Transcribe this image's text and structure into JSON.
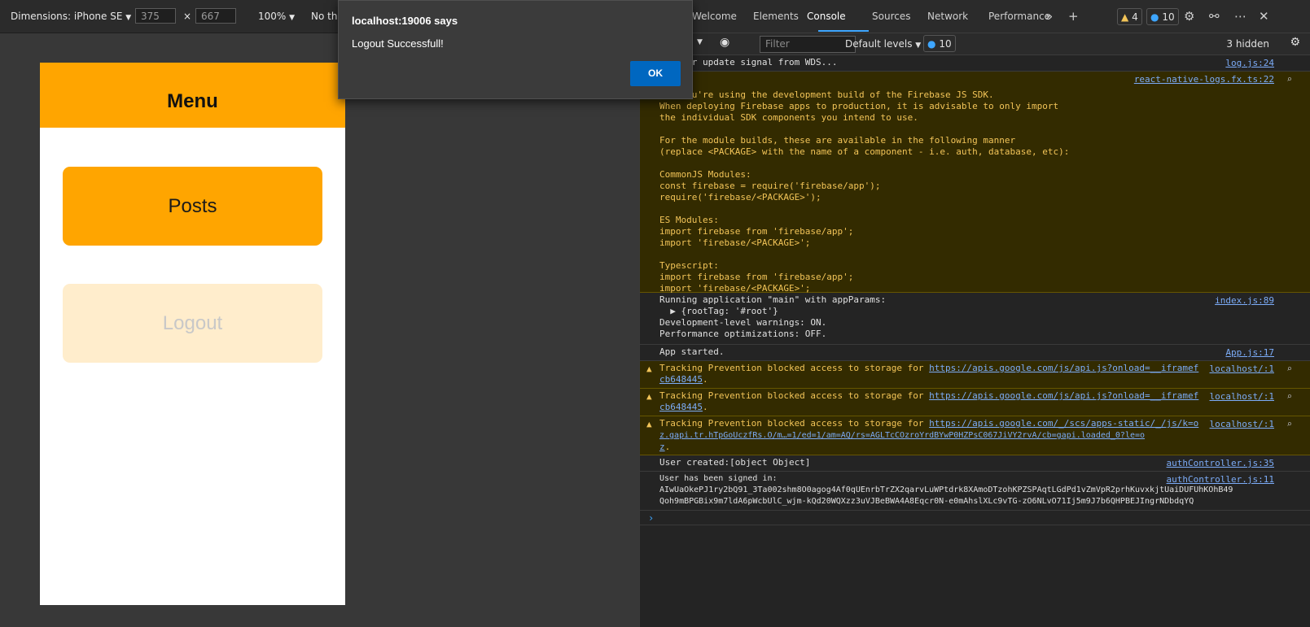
{
  "device_toolbar": {
    "dimensions_label": "Dimensions: iPhone SE",
    "width_value": "375",
    "times": "×",
    "height_value": "667",
    "zoom": "100%",
    "throttle": "No thr"
  },
  "app": {
    "header_title": "Menu",
    "posts_button": "Posts",
    "logout_button": "Logout",
    "header_color": "#FFA500",
    "logout_color": "#FFEDCC"
  },
  "dialog": {
    "title": "localhost:19006 says",
    "message": "Logout Successfull!",
    "ok": "OK"
  },
  "devtools": {
    "tabs": [
      "Welcome",
      "Elements",
      "Console",
      "Sources",
      "Network",
      "Performance"
    ],
    "active_tab": "Console",
    "warnings_count": "4",
    "messages_count": "10",
    "filter_placeholder": "Filter",
    "levels": "Default levels",
    "filter_msg_count": "10",
    "hidden": "3 hidden"
  },
  "console": [
    {
      "type": "log",
      "text": "ing for update signal from WDS...",
      "source": "log.js:24"
    },
    {
      "type": "warn-block",
      "text": "ike you're using the development build of the Firebase JS SDK.\nWhen deploying Firebase apps to production, it is advisable to only import\nthe individual SDK components you intend to use.\n\nFor the module builds, these are available in the following manner\n(replace <PACKAGE> with the name of a component - i.e. auth, database, etc):\n\nCommonJS Modules:\nconst firebase = require('firebase/app');\nrequire('firebase/<PACKAGE>');\n\nES Modules:\nimport firebase from 'firebase/app';\nimport 'firebase/<PACKAGE>';\n\nTypescript:\nimport firebase from 'firebase/app';\nimport 'firebase/<PACKAGE>';",
      "source": "react-native-logs.fx.ts:22"
    },
    {
      "type": "log",
      "text": "Running application \"main\" with appParams:\n  ▶ {rootTag: '#root'}\nDevelopment-level warnings: ON.\nPerformance optimizations: OFF.",
      "source": "index.js:89"
    },
    {
      "type": "log",
      "text": "App started.",
      "source": "App.js:17"
    },
    {
      "type": "warn",
      "text": "Tracking Prevention blocked access to storage for ",
      "link": "https://apis.google.com/js/api.js?onload=__iframefcb648445",
      "link1": "https://apis.google.com/js/api.js?onload=__iframef",
      "link2": "cb648445",
      "source": "localhost/:1"
    },
    {
      "type": "warn",
      "text": "Tracking Prevention blocked access to storage for ",
      "link1": "https://apis.google.com/js/api.js?onload=__iframef",
      "link2": "cb648445",
      "source": "localhost/:1"
    },
    {
      "type": "warn",
      "text": "Tracking Prevention blocked access to storage for ",
      "link1": "https://apis.google.com/_/scs/apps-static/_/js/k=o",
      "link2": "z.gapi.tr.hTpGoUczfRs.O/m…=1/ed=1/am=AQ/rs=AGLTcCOzroYrdBYwP0HZPsC067JiVY2rvA/cb=gapi.loaded_0?le=o",
      "link3": "z",
      "source": "localhost/:1"
    },
    {
      "type": "log",
      "text": "User created:[object Object]",
      "source": "authController.js:35"
    },
    {
      "type": "log",
      "text": "User has been signed in:\nAIwUaOkePJ1ry2bQ91_3Ta002shm8O0agog4Af0qUEnrbTrZX2qarvLuWPtdrk8XAmoDTzohKPZSPAqtLGdPd1vZmVpR2prhKuvxkjtUaiDUFUhKOhB49\nQoh9mBPGBix9m7ldA6pWcbUlC_wjm-kQd20WQXzz3uVJBeBWA4A8Eqcr0N-e0mAhslXLc9vTG-zO6NLvO71Ij5m9J7b6QHPBEJIngrNDbdqYQ",
      "source": "authController.js:11"
    }
  ]
}
